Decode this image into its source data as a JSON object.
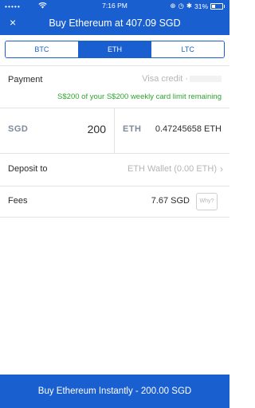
{
  "status_bar": {
    "carrier": "•••••",
    "time": "7:16 PM",
    "alarm_icon": "⊕",
    "battery_text": "31%",
    "battery_level": 0.31
  },
  "nav": {
    "close_icon": "×",
    "title": "Buy Ethereum at 407.09 SGD"
  },
  "tabs": [
    {
      "label": "BTC",
      "active": false
    },
    {
      "label": "ETH",
      "active": true
    },
    {
      "label": "LTC",
      "active": false
    }
  ],
  "payment": {
    "label": "Payment",
    "value": "Visa credit ·",
    "limit_note": "S$200 of your S$200 weekly card limit remaining"
  },
  "amounts": {
    "fiat_currency": "SGD",
    "fiat_value": "200",
    "crypto_currency": "ETH",
    "crypto_value": "0.47245658 ETH"
  },
  "deposit": {
    "label": "Deposit to",
    "value": "ETH Wallet (0.00 ETH)"
  },
  "fees": {
    "label": "Fees",
    "value": "7.67 SGD",
    "why_label": "Why?"
  },
  "buy_button": {
    "label": "Buy Ethereum Instantly - 200.00 SGD"
  },
  "colors": {
    "primary": "#1a5fd0",
    "success": "#2fa32f",
    "muted": "#b5b5b5"
  }
}
